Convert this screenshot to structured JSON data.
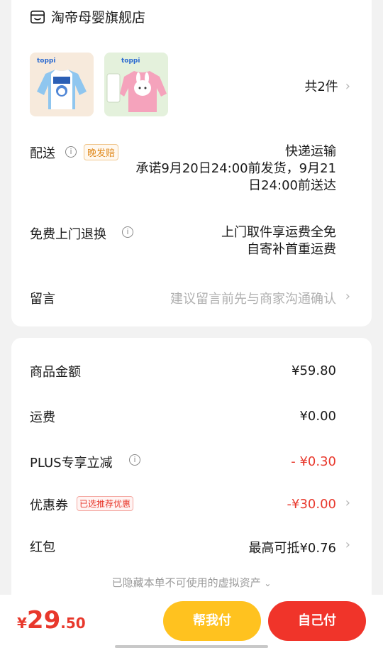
{
  "store": {
    "name": "淘帝母婴旗舰店",
    "icon": "store-icon"
  },
  "items": {
    "count_label": "共2件",
    "thumbs": [
      {
        "brand": "toppi",
        "alt": "blue white long-sleeve tee with cartoon print"
      },
      {
        "brand": "toppi",
        "alt": "pink long-sleeve tee with bunny print"
      }
    ]
  },
  "delivery": {
    "label": "配送",
    "tag": "晚发赔",
    "method": "快递运输",
    "promise_line1": "承诺9月20日24:00前发货，9月21",
    "promise_line2": "日24:00前送达"
  },
  "return_service": {
    "label": "免费上门退换",
    "line1": "上门取件享运费全免",
    "line2": "自寄补首重运费"
  },
  "message": {
    "label": "留言",
    "placeholder": "建议留言前先与商家沟通确认"
  },
  "summary": {
    "goods_amount_label": "商品金额",
    "goods_amount": "¥59.80",
    "shipping_label": "运费",
    "shipping": "¥0.00",
    "plus_label": "PLUS专享立减",
    "plus_discount": "- ¥0.30",
    "coupon_label": "优惠券",
    "coupon_tag": "已选推荐优惠",
    "coupon_discount": "-¥30.00",
    "redpacket_label": "红包",
    "redpacket_value": "最高可抵¥0.76",
    "hidden_assets": "已隐藏本单不可使用的虚拟资产"
  },
  "footer": {
    "price_symbol": "¥",
    "price_int": "29",
    "price_dec": ".50",
    "help_button": "帮我付",
    "pay_button": "自己付"
  },
  "colors": {
    "accent_red": "#e8382c",
    "accent_yellow": "#ffc21f",
    "tag_orange": "#e08a1e"
  }
}
